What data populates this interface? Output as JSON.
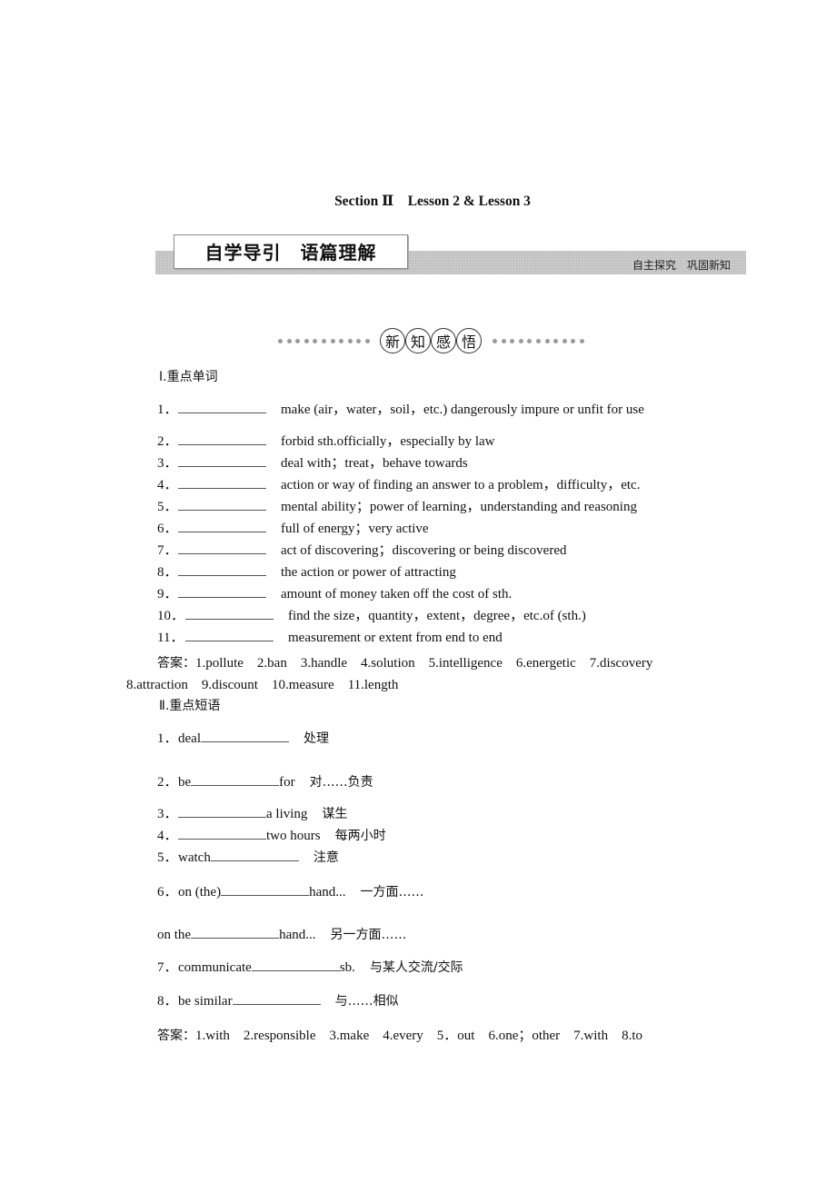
{
  "document": {
    "title": "Section Ⅱ　Lesson 2 & Lesson 3",
    "banner": {
      "title": "自学导引　语篇理解",
      "right_label": "自主探究　巩固新知"
    },
    "badge_chars": [
      "新",
      "知",
      "感",
      "悟"
    ],
    "section1": {
      "heading": "Ⅰ.重点单词",
      "items": [
        {
          "num": "1．",
          "definition": "make (air，water，soil，etc.) dangerously impure or unfit for use"
        },
        {
          "num": "2．",
          "definition": "forbid sth.officially，especially by law"
        },
        {
          "num": "3．",
          "definition": "deal with；treat，behave towards"
        },
        {
          "num": "4．",
          "definition": "action or way of finding an answer to a problem，difficulty，etc."
        },
        {
          "num": "5．",
          "definition": "mental ability；power of learning，understanding and reasoning"
        },
        {
          "num": "6．",
          "definition": "full of energy；very active"
        },
        {
          "num": "7．",
          "definition": "act of discovering；discovering or being discovered"
        },
        {
          "num": "8．",
          "definition": "the action or power of attracting"
        },
        {
          "num": "9．",
          "definition": "amount of money taken off the cost of sth."
        },
        {
          "num": "10．",
          "definition": "find the size，quantity，extent，degree，etc.of (sth.)"
        },
        {
          "num": "11．",
          "definition": "measurement or extent from end to end"
        }
      ],
      "answer_label": "答案：",
      "answer_line1": "1.pollute　2.ban　3.handle　4.solution　5.intelligence　6.energetic　7.discovery",
      "answer_line2": "8.attraction　9.discount　10.measure　11.length"
    },
    "section2": {
      "heading": "Ⅱ.重点短语",
      "items": [
        {
          "num": "1．",
          "before": "deal",
          "after": "",
          "meaning": "处理"
        },
        {
          "num": "2．",
          "before": "be",
          "after": "for",
          "meaning": "对……负责"
        },
        {
          "num": "3．",
          "before": "",
          "after": "a living",
          "meaning": "谋生"
        },
        {
          "num": "4．",
          "before": "",
          "after": "two hours",
          "meaning": "每两小时"
        },
        {
          "num": "5．",
          "before": "watch",
          "after": "",
          "meaning": "注意"
        },
        {
          "num": "6．",
          "before": "on (the)",
          "after": "hand...",
          "meaning": "一方面……"
        },
        {
          "num": "",
          "before": "on the",
          "after": "hand...",
          "meaning": "另一方面……"
        },
        {
          "num": "7．",
          "before": "communicate",
          "after": "sb.",
          "meaning": "与某人交流/交际"
        },
        {
          "num": "8．",
          "before": "be similar",
          "after": "",
          "meaning": "与……相似"
        }
      ],
      "answer_label": "答案：",
      "answer_text": "1.with　2.responsible　3.make　4.every　5．out　6.one；other　7.with　8.to"
    }
  }
}
